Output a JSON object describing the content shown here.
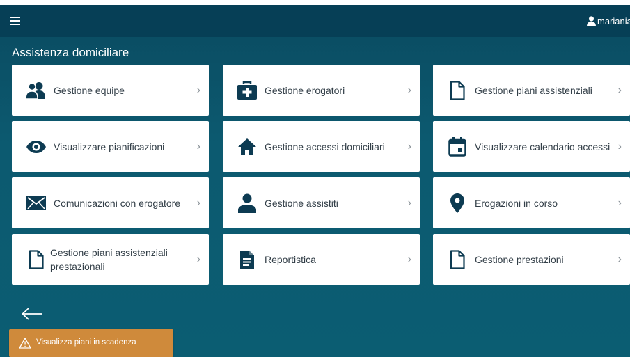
{
  "header": {
    "menu_icon": "hamburger-icon",
    "user_icon": "user-icon",
    "username": "mariania"
  },
  "page": {
    "title": "Assistenza domiciliare"
  },
  "tiles": [
    {
      "label": "Gestione equipe",
      "icon": "group-icon"
    },
    {
      "label": "Gestione erogatori",
      "icon": "medical-kit-icon"
    },
    {
      "label": "Gestione piani assistenziali",
      "icon": "document-icon"
    },
    {
      "label": "Visualizzare pianificazioni",
      "icon": "eye-icon"
    },
    {
      "label": "Gestione accessi domiciliari",
      "icon": "home-icon"
    },
    {
      "label": "Visualizzare calendario accessi",
      "icon": "calendar-icon"
    },
    {
      "label": "Comunicazioni con erogatore",
      "icon": "envelope-icon"
    },
    {
      "label": "Gestione assistiti",
      "icon": "person-icon"
    },
    {
      "label": "Erogazioni in corso",
      "icon": "location-pin-icon"
    },
    {
      "label": "Gestione piani assistenziali prestazionali",
      "icon": "document-icon"
    },
    {
      "label": "Reportistica",
      "icon": "report-icon"
    },
    {
      "label": "Gestione prestazioni",
      "icon": "document-icon"
    }
  ],
  "chevron": "›",
  "toast": {
    "text": "Visualizza piani in scadenza",
    "icon": "warning-icon"
  },
  "back_icon": "arrow-left-icon",
  "colors": {
    "header_bg": "#063f56",
    "page_bg": "#0b5a70",
    "icon": "#0d3b52",
    "toast_bg": "#cf8a3b"
  }
}
